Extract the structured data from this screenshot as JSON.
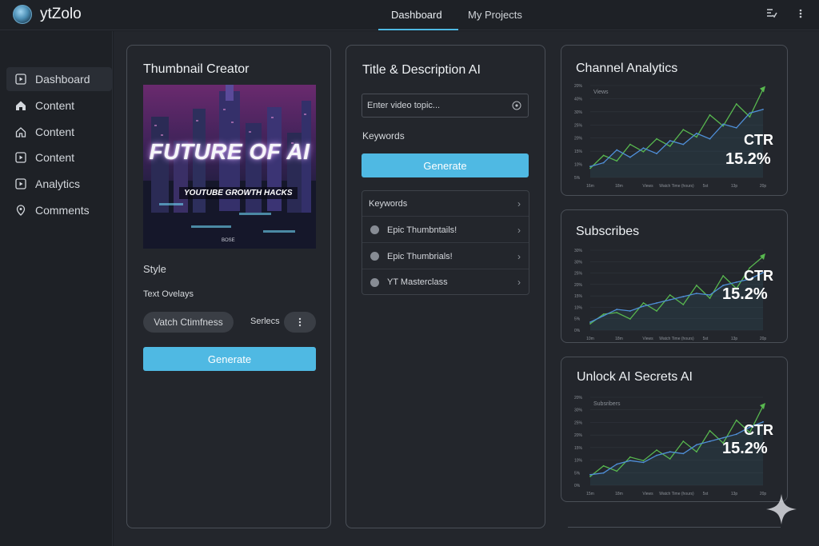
{
  "app": {
    "title": "ytZolo"
  },
  "nav": {
    "tabs": [
      {
        "label": "Dashboard",
        "active": true
      },
      {
        "label": "My Projects",
        "active": false
      }
    ]
  },
  "topbar_icons": [
    "checklist-icon",
    "more-vertical-icon"
  ],
  "sidebar": {
    "items": [
      {
        "label": "Dashboard",
        "icon": "play-square-icon",
        "active": true
      },
      {
        "label": "Content",
        "icon": "home-icon"
      },
      {
        "label": "Content",
        "icon": "house-outline-icon"
      },
      {
        "label": "Content",
        "icon": "play-square-icon"
      },
      {
        "label": "Analytics",
        "icon": "play-square-icon"
      },
      {
        "label": "Comments",
        "icon": "location-pin-icon"
      }
    ]
  },
  "thumbnail_creator": {
    "title": "Thumbnail Creator",
    "preview": {
      "headline": "FUTURE OF AI",
      "subheadline": "YOUTUBE GROWTH HACKS",
      "tag": "BOSE"
    },
    "style_label": "Style",
    "overlays_label": "Text Ovelays",
    "overlay_pill": "Vatch Ctimfness",
    "select_label": "Serlecs",
    "generate_label": "Generate"
  },
  "title_ai": {
    "title": "Title & Description AI",
    "topic_placeholder": "Enter video topic...",
    "keywords_label": "Keywords",
    "generate_label": "Generate",
    "list_header": "Keywords",
    "keywords": [
      "Epic Thumbntails!",
      "Epic Thumbrials!",
      "YT Masterclass"
    ]
  },
  "analytics_cards": [
    {
      "title": "Channel Analytics",
      "chart_label": "Views",
      "ctr_label": "CTR",
      "ctr_value": "15.2%"
    },
    {
      "title": "Subscribes",
      "chart_label": "",
      "ctr_label": "CTR",
      "ctr_value": "15.2%"
    },
    {
      "title": "Unlock AI Secrets AI",
      "chart_label": "Subsribers",
      "ctr_label": "CTR",
      "ctr_value": "15.2%"
    }
  ],
  "chart_data": [
    {
      "type": "line",
      "title": "Channel Analytics",
      "ylabel": "Views",
      "y_ticks": [
        "5%",
        "10%",
        "15%",
        "20%",
        "25%",
        "30%",
        "40%",
        "20%"
      ],
      "x_ticks": [
        "16m",
        "18m",
        "Views",
        "Watch Time (hours)",
        "5st",
        "13p",
        "20p"
      ],
      "series": [
        {
          "name": "Views",
          "color": "#58b84f",
          "values": [
            5,
            12,
            9,
            18,
            14,
            21,
            17,
            26,
            22,
            34,
            28,
            40,
            33,
            48
          ]
        },
        {
          "name": "Watch Time (hours)",
          "color": "#4f8fd8",
          "values": [
            6,
            8,
            15,
            11,
            16,
            13,
            20,
            18,
            24,
            21,
            29,
            27,
            35,
            37
          ]
        }
      ]
    },
    {
      "type": "line",
      "title": "Subscribes",
      "y_ticks": [
        "0%",
        "5%",
        "10%",
        "15%",
        "20%",
        "25%",
        "30%",
        "30%"
      ],
      "x_ticks": [
        "10m",
        "18m",
        "Views",
        "Watch Time (hours)",
        "5st",
        "13p",
        "20p"
      ],
      "series": [
        {
          "name": "Views",
          "color": "#58b84f",
          "values": [
            4,
            10,
            11,
            7,
            17,
            12,
            22,
            16,
            28,
            20,
            34,
            26,
            39,
            46
          ]
        },
        {
          "name": "Watch Time (hours)",
          "color": "#4f8fd8",
          "values": [
            5,
            9,
            13,
            12,
            15,
            17,
            19,
            21,
            23,
            22,
            28,
            30,
            32,
            36
          ]
        }
      ]
    },
    {
      "type": "line",
      "title": "Unlock AI Secrets AI",
      "ylabel": "Subsribers",
      "y_ticks": [
        "0%",
        "5%",
        "10%",
        "15%",
        "20%",
        "25%",
        "30%",
        "20%"
      ],
      "x_ticks": [
        "15m",
        "18m",
        "Views",
        "Watch Time (hours)",
        "5st",
        "13p",
        "20p"
      ],
      "series": [
        {
          "name": "Views",
          "color": "#58b84f",
          "values": [
            5,
            11,
            8,
            16,
            14,
            20,
            15,
            25,
            19,
            31,
            24,
            37,
            30,
            45
          ]
        },
        {
          "name": "Watch Time (hours)",
          "color": "#4f8fd8",
          "values": [
            6,
            7,
            12,
            14,
            13,
            17,
            19,
            18,
            23,
            25,
            27,
            29,
            33,
            36
          ]
        }
      ]
    }
  ]
}
